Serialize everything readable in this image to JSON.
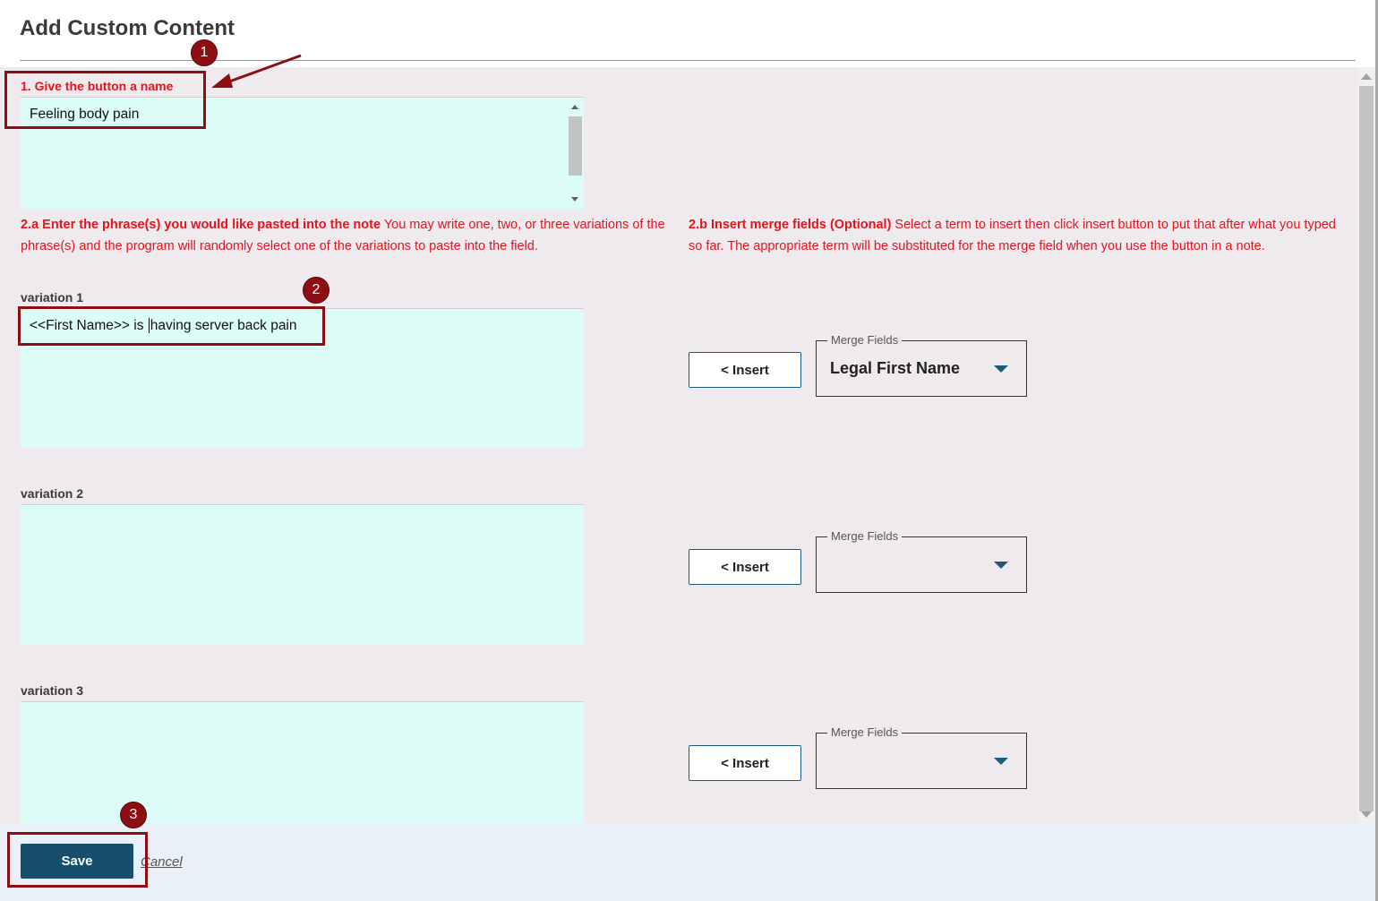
{
  "dialog": {
    "title": "Add Custom Content"
  },
  "name_section": {
    "label": "1. Give the button a name",
    "value": "Feeling body pain"
  },
  "phrase_section": {
    "heading": "2.a Enter the phrase(s) you would like pasted into the note",
    "description": " You may write one, two, or three variations of the phrase(s) and the program will randomly select one of the variations to paste into the field."
  },
  "merge_section": {
    "heading": "2.b Insert merge fields (Optional)",
    "description": " Select a term to insert then click insert button to put that after what you typed so far. The appropriate term will be substituted for the merge field when you use the button in a note."
  },
  "variations": [
    {
      "label": "variation 1",
      "value_before_cursor": "<<First Name>> is ",
      "value_after_cursor": "having server back pain",
      "insert_label": "< Insert",
      "merge_legend": "Merge Fields",
      "merge_value": "Legal First Name"
    },
    {
      "label": "variation 2",
      "value_before_cursor": "",
      "value_after_cursor": "",
      "insert_label": "< Insert",
      "merge_legend": "Merge Fields",
      "merge_value": ""
    },
    {
      "label": "variation 3",
      "value_before_cursor": "",
      "value_after_cursor": "",
      "insert_label": "< Insert",
      "merge_legend": "Merge Fields",
      "merge_value": ""
    }
  ],
  "footer": {
    "save_label": "Save",
    "cancel_label": "Cancel"
  },
  "annotations": {
    "badge1": "1",
    "badge2": "2",
    "badge3": "3",
    "color": "#8d0f14"
  },
  "colors": {
    "accent": "#174e6e",
    "label_red": "#e4151f",
    "textarea_bg": "#dcfdf7",
    "panel_bg": "#efeaed"
  }
}
